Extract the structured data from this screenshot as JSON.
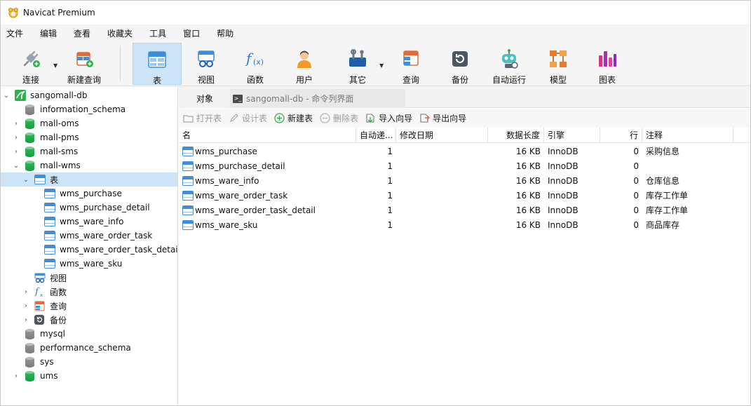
{
  "window": {
    "title": "Navicat Premium"
  },
  "menu": [
    "文件",
    "编辑",
    "查看",
    "收藏夹",
    "工具",
    "窗口",
    "帮助"
  ],
  "toolbar": {
    "connect": "连接",
    "new_query": "新建查询",
    "table": "表",
    "view": "视图",
    "function": "函数",
    "user": "用户",
    "other": "其它",
    "query": "查询",
    "backup": "备份",
    "automation": "自动运行",
    "model": "模型",
    "chart": "图表"
  },
  "tree": {
    "connection": "sangomall-db",
    "databases": {
      "information_schema": "information_schema",
      "mall_oms": "mall-oms",
      "mall_pms": "mall-pms",
      "mall_sms": "mall-sms",
      "mall_wms": "mall-wms",
      "mysql": "mysql",
      "performance_schema": "performance_schema",
      "sys": "sys",
      "ums": "ums"
    },
    "wms_children": {
      "tables": "表",
      "views": "视图",
      "functions": "函数",
      "queries": "查询",
      "backups": "备份"
    },
    "tables": [
      "wms_purchase",
      "wms_purchase_detail",
      "wms_ware_info",
      "wms_ware_order_task",
      "wms_ware_order_task_detail",
      "wms_ware_sku"
    ]
  },
  "tabs": {
    "objects": "对象",
    "console": "sangomall-db - 命令列界面"
  },
  "object_toolbar": {
    "open_table": "打开表",
    "design_table": "设计表",
    "new_table": "新建表",
    "delete_table": "删除表",
    "import_wizard": "导入向导",
    "export_wizard": "导出向导"
  },
  "grid": {
    "headers": {
      "name": "名",
      "auto_increment": "自动递...",
      "modified": "修改日期",
      "data_length": "数据长度",
      "engine": "引擎",
      "rows": "行",
      "comment": "注释"
    },
    "rows": [
      {
        "name": "wms_purchase",
        "auto_increment": "1",
        "modified": "",
        "data_length": "16 KB",
        "engine": "InnoDB",
        "rows": "0",
        "comment": "采购信息"
      },
      {
        "name": "wms_purchase_detail",
        "auto_increment": "1",
        "modified": "",
        "data_length": "16 KB",
        "engine": "InnoDB",
        "rows": "0",
        "comment": ""
      },
      {
        "name": "wms_ware_info",
        "auto_increment": "1",
        "modified": "",
        "data_length": "16 KB",
        "engine": "InnoDB",
        "rows": "0",
        "comment": "仓库信息"
      },
      {
        "name": "wms_ware_order_task",
        "auto_increment": "1",
        "modified": "",
        "data_length": "16 KB",
        "engine": "InnoDB",
        "rows": "0",
        "comment": "库存工作单"
      },
      {
        "name": "wms_ware_order_task_detail",
        "auto_increment": "1",
        "modified": "",
        "data_length": "16 KB",
        "engine": "InnoDB",
        "rows": "0",
        "comment": "库存工作单"
      },
      {
        "name": "wms_ware_sku",
        "auto_increment": "1",
        "modified": "",
        "data_length": "16 KB",
        "engine": "InnoDB",
        "rows": "0",
        "comment": "商品库存"
      }
    ]
  },
  "colors": {
    "accent_blue": "#3d8fdc",
    "selection": "#cce4f7",
    "db_green": "#1fae4c",
    "db_gray": "#8a8a8a"
  }
}
